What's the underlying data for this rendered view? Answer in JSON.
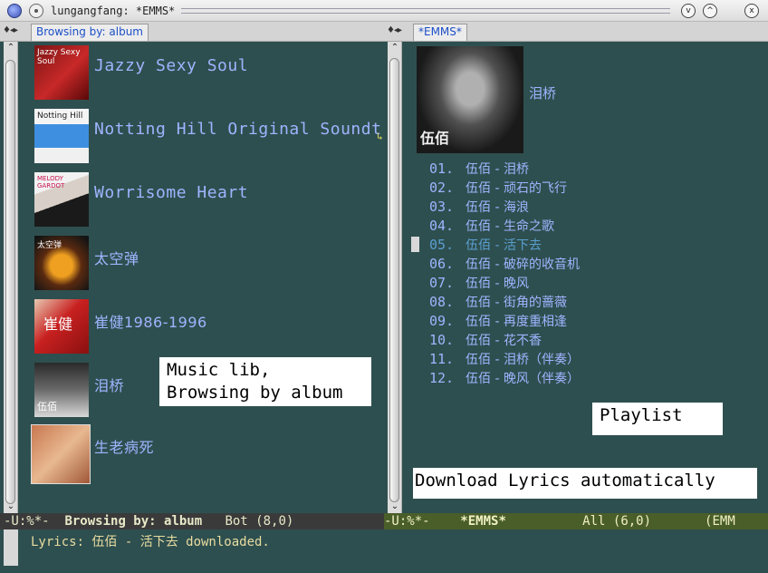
{
  "window": {
    "title": "lungangfang: *EMMS*",
    "minimize_glyph": "v",
    "maximize_glyph": "^",
    "close_glyph": "x"
  },
  "left_pane": {
    "tab_label": "Browsing by: album",
    "albums": [
      {
        "title": "Jazzy Sexy Soul",
        "cover_text": "Jazzy Sexy Soul"
      },
      {
        "title": "Notting Hill Original Soundt",
        "cover_text": "Notting Hill"
      },
      {
        "title": "Worrisome Heart",
        "cover_text": "MELODY GARDOT"
      },
      {
        "title": "太空弹",
        "cover_text": "太空弹"
      },
      {
        "title": "崔健1986-1996",
        "cover_text": "崔健"
      },
      {
        "title": "泪桥",
        "cover_text": "伍佰"
      },
      {
        "title": "生老病死",
        "cover_text": ""
      }
    ]
  },
  "right_pane": {
    "tab_label": "*EMMS*",
    "album_name": "泪桥",
    "cover_text": "伍佰",
    "tracks": [
      {
        "num": "01.",
        "text": "伍佰 - 泪桥"
      },
      {
        "num": "02.",
        "text": "伍佰 - 顽石的飞行"
      },
      {
        "num": "03.",
        "text": "伍佰 - 海浪"
      },
      {
        "num": "04.",
        "text": "伍佰 - 生命之歌"
      },
      {
        "num": "05.",
        "text": "伍佰 - 活下去"
      },
      {
        "num": "06.",
        "text": "伍佰 - 破碎的收音机"
      },
      {
        "num": "07.",
        "text": "伍佰 - 晚风"
      },
      {
        "num": "08.",
        "text": "伍佰 - 街角的蔷薇"
      },
      {
        "num": "09.",
        "text": "伍佰 - 再度重相逢"
      },
      {
        "num": "10.",
        "text": "伍佰 - 花不香"
      },
      {
        "num": "11.",
        "text": "伍佰 - 泪桥（伴奏）"
      },
      {
        "num": "12.",
        "text": "伍佰 - 晚风（伴奏）"
      }
    ],
    "current_track": 5
  },
  "annotations": {
    "music_lib": "Music lib,\nBrowsing by album",
    "playlist": "Playlist",
    "lyrics": "Download Lyrics automatically"
  },
  "modeline_left": {
    "status": "-U:%*-",
    "buffer": "Browsing by: album",
    "position": "Bot (8,0)"
  },
  "modeline_right": {
    "status": "-U:%*-",
    "buffer": "*EMMS*",
    "position": "All (6,0)",
    "mode": "(EMM"
  },
  "minibuffer": {
    "message": "Lyrics: 伍佰 - 活下去 downloaded."
  }
}
